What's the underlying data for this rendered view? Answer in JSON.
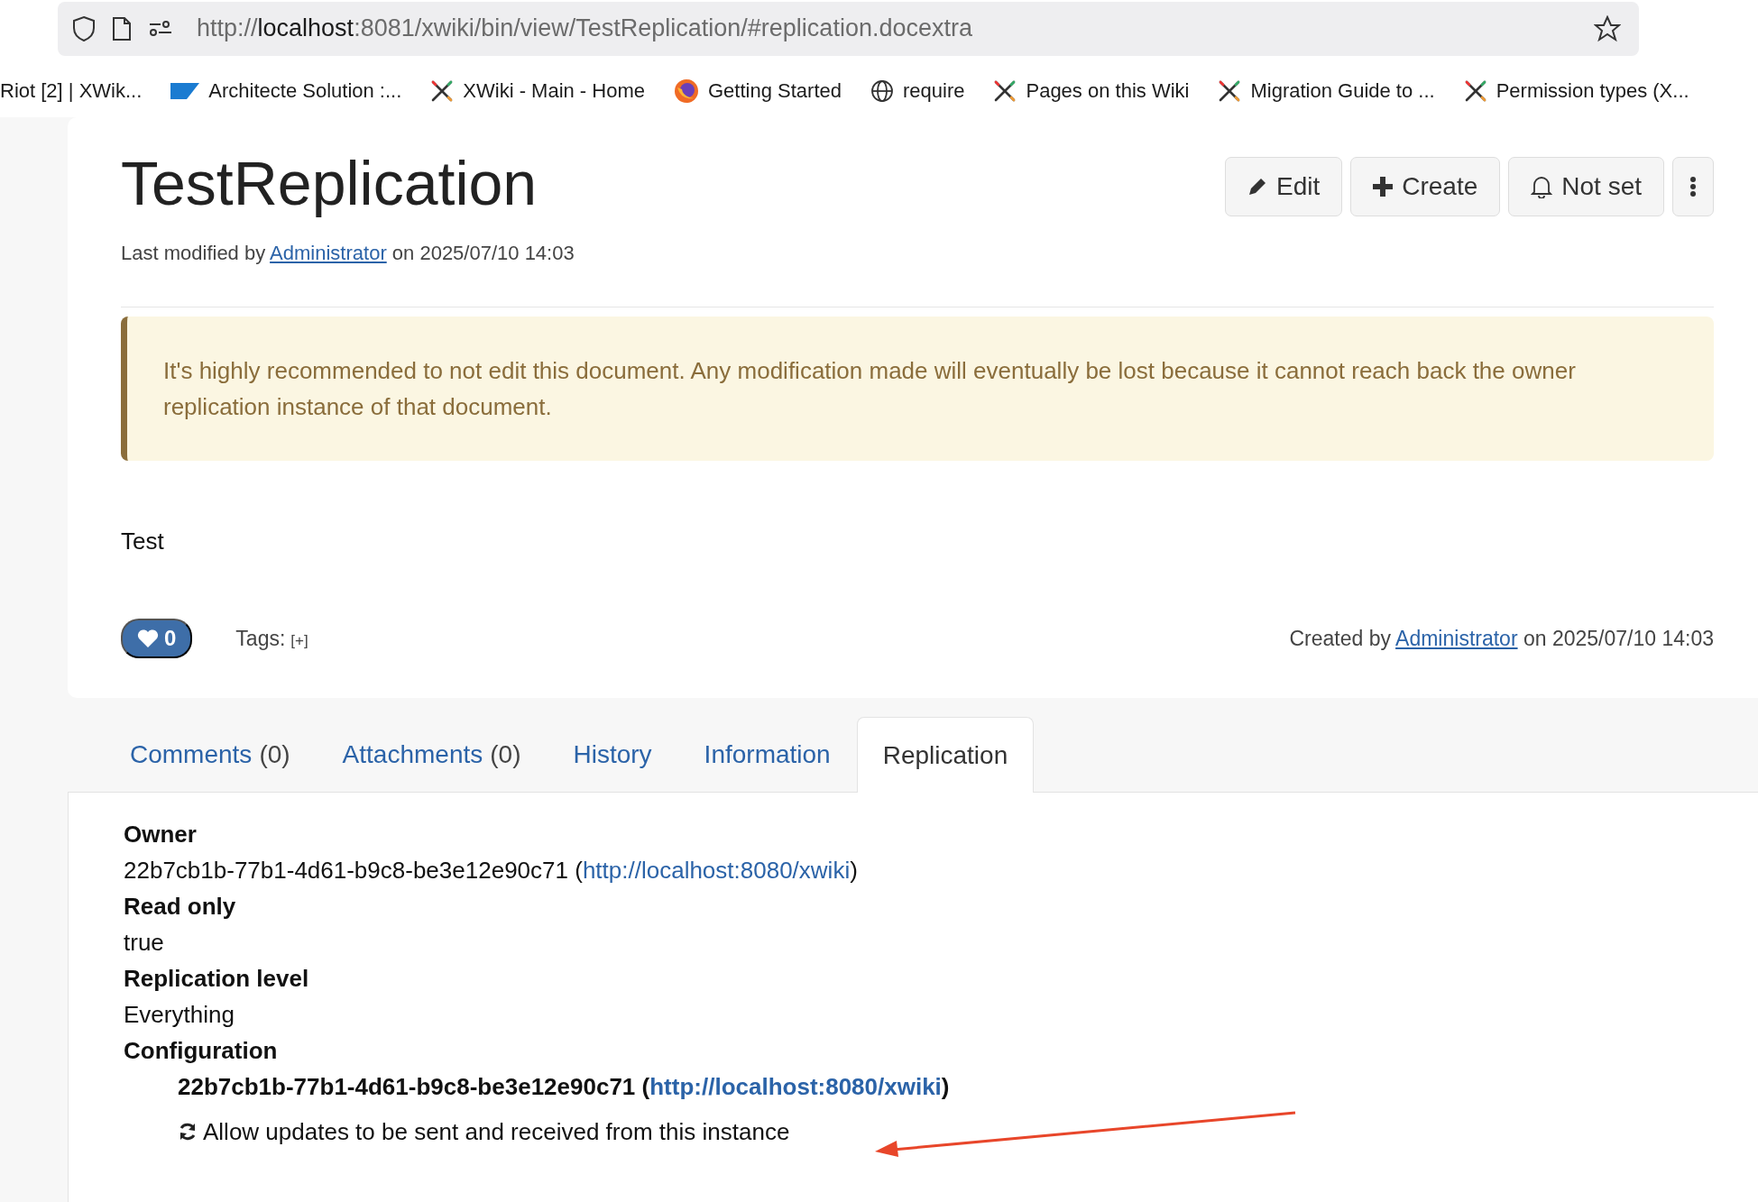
{
  "browser": {
    "url": {
      "scheme": "http://",
      "host": "localhost",
      "path": ":8081/xwiki/bin/view/TestReplication/#replication.docextra"
    },
    "bookmarks": [
      {
        "kind": "none",
        "label": "Riot [2] | XWik..."
      },
      {
        "kind": "sap",
        "label": "Architecte Solution :..."
      },
      {
        "kind": "xwiki",
        "label": "XWiki - Main - Home"
      },
      {
        "kind": "firefox",
        "label": "Getting Started"
      },
      {
        "kind": "globe",
        "label": "require"
      },
      {
        "kind": "xwiki",
        "label": "Pages on this Wiki"
      },
      {
        "kind": "xwiki",
        "label": "Migration Guide to ..."
      },
      {
        "kind": "xwiki",
        "label": "Permission types (X..."
      }
    ]
  },
  "page": {
    "title": "TestReplication",
    "modified": {
      "prefix": "Last modified by",
      "author": "Administrator",
      "suffix": "on 2025/07/10 14:03"
    },
    "actions": [
      {
        "kind": "edit",
        "label": "Edit"
      },
      {
        "kind": "create",
        "label": "Create"
      },
      {
        "kind": "notify",
        "label": "Not set"
      },
      {
        "kind": "more"
      }
    ],
    "warning": "It's highly recommended to not edit this document. Any modification made will eventually be lost because it cannot reach back the owner replication instance of that document.",
    "content": "Test",
    "likes": "0",
    "tags": {
      "label": "Tags:",
      "add": "[+]"
    },
    "created": {
      "prefix": "Created by",
      "author": "Administrator",
      "suffix": "on 2025/07/10 14:03"
    }
  },
  "tabs": [
    {
      "label": "Comments",
      "count": "(0)",
      "selected": false
    },
    {
      "label": "Attachments",
      "count": "(0)",
      "selected": false
    },
    {
      "label": "History",
      "selected": false
    },
    {
      "label": "Information",
      "selected": false
    },
    {
      "label": "Replication",
      "selected": true
    }
  ],
  "replication": {
    "owner": {
      "label": "Owner",
      "id": "22b7cb1b-77b1-4d61-b9c8-be3e12e90c71",
      "open": "(",
      "url": "http://localhost:8080/xwiki",
      "close": ")"
    },
    "read_only": {
      "label": "Read only",
      "value": "true"
    },
    "level": {
      "label": "Replication level",
      "value": "Everything"
    },
    "configuration": {
      "label": "Configuration",
      "id": "22b7cb1b-77b1-4d61-b9c8-be3e12e90c71",
      "open": "(",
      "url": "http://localhost:8080/xwiki",
      "close": ")",
      "option": "Allow updates to be sent and received from this instance"
    }
  }
}
